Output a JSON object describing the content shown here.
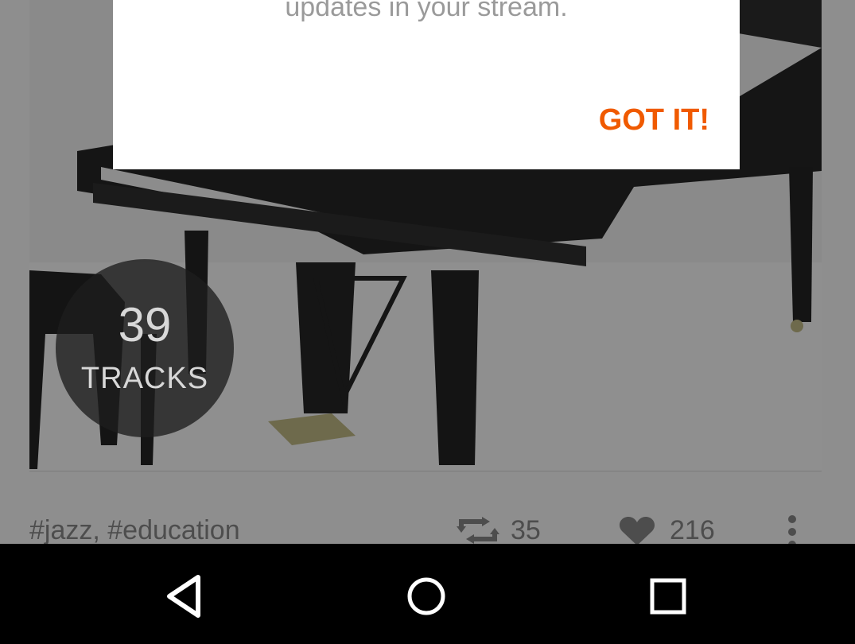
{
  "dialog": {
    "message": "updates in your stream.",
    "confirm_label": "GOT IT!",
    "accent_color": "#f05a00"
  },
  "playlist": {
    "track_count": "39",
    "track_label": "TRACKS",
    "tags": "#jazz, #education",
    "reposts": "35",
    "likes": "216"
  },
  "icons": {
    "repost": "repost-icon",
    "like": "heart-icon",
    "more": "more-vertical-icon",
    "back": "back-triangle-icon",
    "home": "home-circle-icon",
    "recents": "recents-square-icon"
  }
}
